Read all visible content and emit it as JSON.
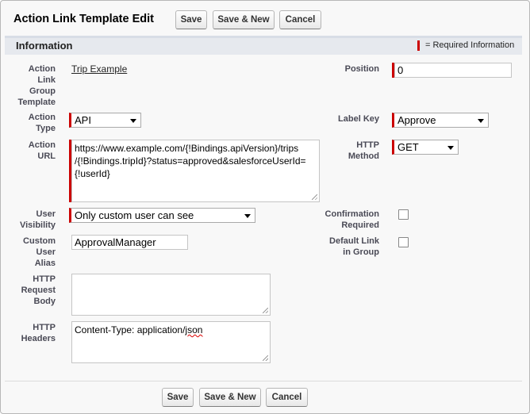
{
  "header": {
    "title": "Action Link Template Edit",
    "save_label": "Save",
    "save_new_label": "Save & New",
    "cancel_label": "Cancel"
  },
  "section": {
    "title": "Information",
    "required_note": "= Required Information"
  },
  "fields": {
    "group_template": {
      "label_lines": [
        "Action",
        "Link",
        "Group",
        "Template"
      ],
      "value": "Trip Example"
    },
    "position": {
      "label": "Position",
      "value": "0"
    },
    "action_type": {
      "label_lines": [
        "Action",
        "Type"
      ],
      "value": "API"
    },
    "label_key": {
      "label": "Label Key",
      "value": "Approve"
    },
    "action_url": {
      "label_lines": [
        "Action",
        "URL"
      ],
      "value_lines": [
        "https://www.example.com/{!Bindings.apiVersion}/trips",
        "/{!Bindings.tripId}?status=approved&salesforceUserId=",
        "{!userId}"
      ]
    },
    "http_method": {
      "label_lines": [
        "HTTP",
        "Method"
      ],
      "value": "GET"
    },
    "user_visibility": {
      "label_lines": [
        "User",
        "Visibility"
      ],
      "value": "Only custom user can see"
    },
    "confirmation_required": {
      "label_lines": [
        "Confirmation",
        "Required"
      ],
      "checked": false
    },
    "custom_user_alias": {
      "label_lines": [
        "Custom",
        "User",
        "Alias"
      ],
      "value": "ApprovalManager"
    },
    "default_link": {
      "label_lines": [
        "Default Link",
        "in Group"
      ],
      "checked": false
    },
    "http_request_body": {
      "label_lines": [
        "HTTP",
        "Request",
        "Body"
      ],
      "value": ""
    },
    "http_headers": {
      "label_lines": [
        "HTTP",
        "Headers"
      ],
      "value_prefix": "Content-Type: application/",
      "value_misspelled": "json"
    }
  },
  "footer": {
    "save_label": "Save",
    "save_new_label": "Save & New",
    "cancel_label": "Cancel"
  },
  "colors": {
    "required": "#cc0000",
    "section_bg": "#e6e9ee",
    "label": "#4a4a56"
  }
}
